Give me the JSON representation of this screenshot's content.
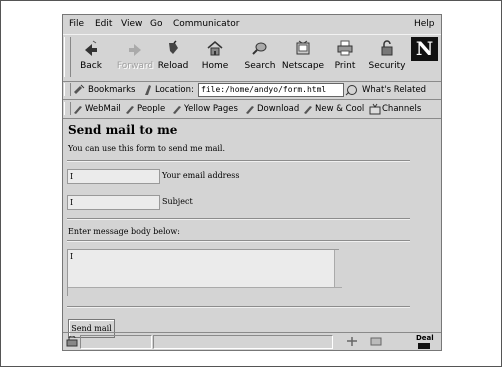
{
  "menu": [
    "File",
    "Edit",
    "View",
    "Go",
    "Communicator"
  ],
  "menu_help": "Help",
  "toolbar": {
    "buttons": [
      {
        "label": "Back",
        "icon": "back-arrow-icon",
        "disabled": false
      },
      {
        "label": "Forward",
        "icon": "forward-arrow-icon",
        "disabled": true
      },
      {
        "label": "Reload",
        "icon": "reload-icon",
        "disabled": false
      },
      {
        "label": "Home",
        "icon": "home-icon",
        "disabled": false
      },
      {
        "label": "Search",
        "icon": "search-icon",
        "disabled": false
      },
      {
        "label": "Netscape",
        "icon": "netscape-icon",
        "disabled": false
      },
      {
        "label": "Print",
        "icon": "print-icon",
        "disabled": false
      },
      {
        "label": "Security",
        "icon": "security-lock-icon",
        "disabled": false
      }
    ],
    "logo": "N"
  },
  "location": {
    "bookmarks_label": "Bookmarks",
    "location_label": "Location:",
    "url": "file:/home/andyo/form.html",
    "whats_related": "What's Related"
  },
  "personal_toolbar": [
    "WebMail",
    "People",
    "Yellow Pages",
    "Download",
    "New & Cool",
    "Channels"
  ],
  "page": {
    "title": "Send mail to me",
    "intro": "You can use this form to send me mail.",
    "email_value": "I",
    "email_label": "Your email address",
    "subject_value": "I",
    "subject_label": "Subject",
    "message_label": "Enter message body below:",
    "message_value": "I",
    "submit_label": "Send mail"
  },
  "status": {
    "deal_text": "Deal"
  }
}
